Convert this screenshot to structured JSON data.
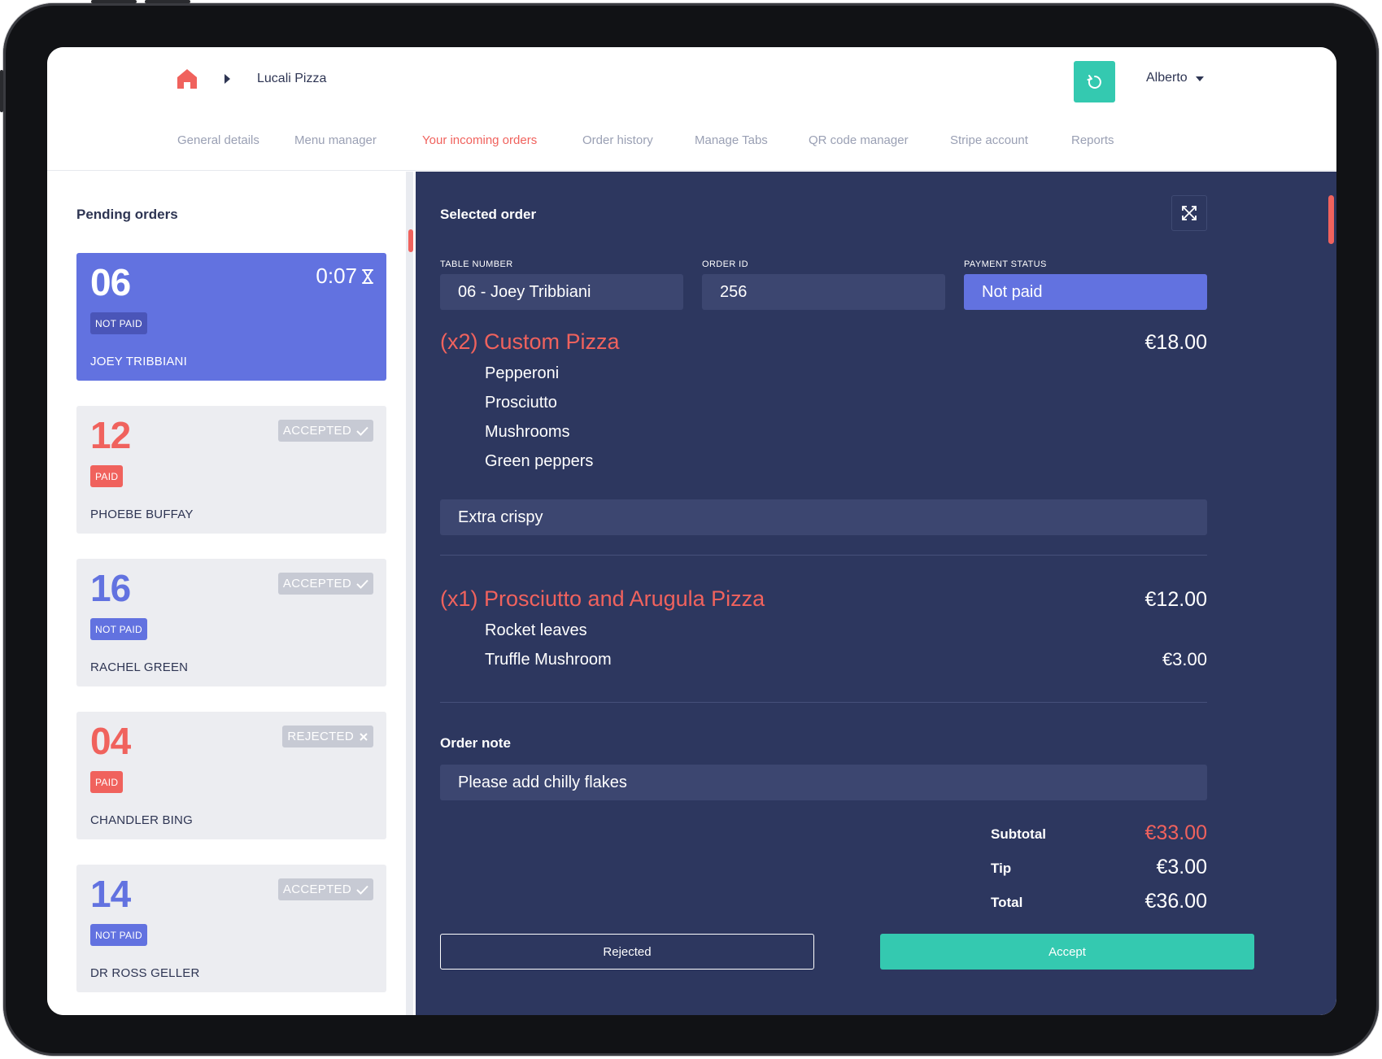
{
  "header": {
    "restaurant_name": "Lucali Pizza",
    "user_name": "Alberto"
  },
  "nav": {
    "items": [
      {
        "label": "General details"
      },
      {
        "label": "Menu manager"
      },
      {
        "label": "Your incoming orders",
        "active": true
      },
      {
        "label": "Order history"
      },
      {
        "label": "Manage Tabs"
      },
      {
        "label": "QR code manager"
      },
      {
        "label": "Stripe account"
      },
      {
        "label": "Reports"
      }
    ]
  },
  "pending": {
    "title": "Pending orders",
    "orders": [
      {
        "number": "06",
        "timer": "0:07",
        "payment": "NOT PAID",
        "name": "JOEY TRIBBIANI",
        "selected": true
      },
      {
        "number": "12",
        "status": "ACCEPTED",
        "payment": "PAID",
        "name": "PHOEBE BUFFAY"
      },
      {
        "number": "16",
        "status": "ACCEPTED",
        "payment": "NOT PAID",
        "name": "RACHEL GREEN"
      },
      {
        "number": "04",
        "status": "REJECTED",
        "payment": "PAID",
        "name": "CHANDLER BING"
      },
      {
        "number": "14",
        "status": "ACCEPTED",
        "payment": "NOT PAID",
        "name": "DR ROSS GELLER"
      }
    ]
  },
  "selected": {
    "title": "Selected order",
    "fields": {
      "table_label": "TABLE NUMBER",
      "table_value": "06 - Joey Tribbiani",
      "order_label": "ORDER ID",
      "order_value": "256",
      "payment_label": "PAYMENT STATUS",
      "payment_value": "Not paid"
    },
    "items": [
      {
        "title": "(x2) Custom Pizza",
        "price": "€18.00",
        "modifiers": [
          {
            "name": "Pepperoni"
          },
          {
            "name": "Prosciutto"
          },
          {
            "name": "Mushrooms"
          },
          {
            "name": "Green peppers"
          }
        ],
        "note": "Extra crispy"
      },
      {
        "title": "(x1) Prosciutto and Arugula Pizza",
        "price": "€12.00",
        "modifiers": [
          {
            "name": "Rocket leaves"
          },
          {
            "name": "Truffle Mushroom",
            "price": "€3.00"
          }
        ]
      }
    ],
    "order_note_title": "Order note",
    "order_note": "Please add chilly flakes",
    "summary": {
      "subtotal_label": "Subtotal",
      "subtotal_value": "€33.00",
      "tip_label": "Tip",
      "tip_value": "€3.00",
      "total_label": "Total",
      "total_value": "€36.00"
    },
    "actions": {
      "reject_label": "Rejected",
      "accept_label": "Accept"
    }
  },
  "colors": {
    "accent_red": "#f0625d",
    "accent_blue": "#6272e0",
    "accent_teal": "#34c9b0",
    "panel_navy": "#2d375f"
  }
}
